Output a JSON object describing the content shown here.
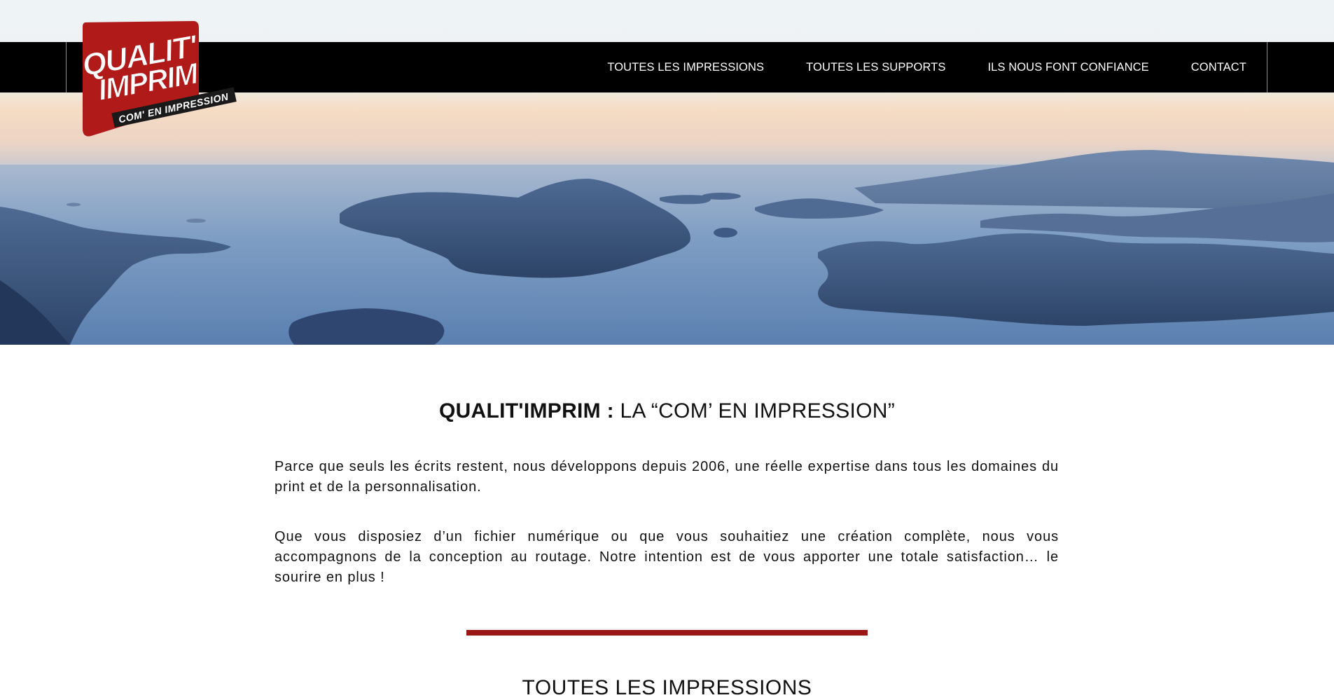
{
  "brand": {
    "logo_line1": "QUALIT'",
    "logo_line2": "IMPRIM",
    "logo_tagline": "COM' EN IMPRESSION",
    "accent_color": "#9b1716",
    "logo_red": "#b01b1a"
  },
  "nav": {
    "items": [
      {
        "label": "TOUTES LES IMPRESSIONS"
      },
      {
        "label": "TOUTES LES SUPPORTS"
      },
      {
        "label": "ILS NOUS FONT CONFIANCE"
      },
      {
        "label": "CONTACT"
      }
    ]
  },
  "hero": {
    "description_icon": "sea-islands-landscape-image"
  },
  "intro": {
    "title_brand": "QUALIT'IMPRIM :",
    "title_rest": "LA “COM’ EN IMPRESSION”",
    "paragraph1": "Parce que seuls les écrits restent, nous développons depuis 2006, une réelle expertise dans tous les domaines du print et de la personnalisation.",
    "paragraph2": "Que vous disposiez d’un fichier numérique ou que vous souhaitiez une création complète, nous vous accompagnons de la conception au routage. Notre intention est de vous apporter une totale satisfaction… le sourire en plus !"
  },
  "section": {
    "title": "TOUTES LES IMPRESSIONS"
  }
}
